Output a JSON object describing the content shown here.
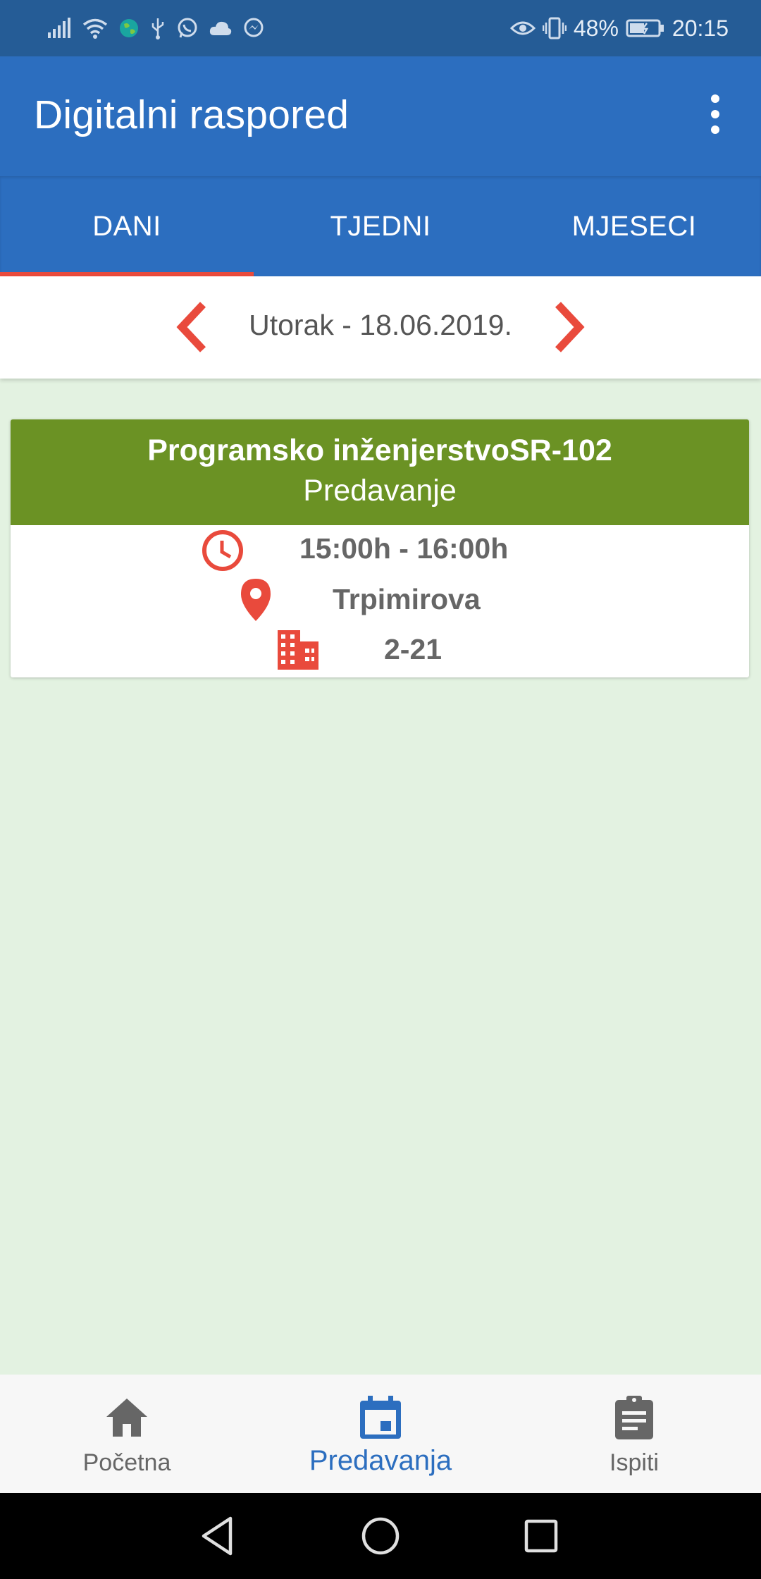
{
  "status_bar": {
    "battery_percent": "48%",
    "time": "20:15",
    "icons": [
      "signal-icon",
      "wifi-icon",
      "globe-icon",
      "usb-icon",
      "whatsapp-icon",
      "cloud-icon",
      "messenger-icon",
      "eye-icon",
      "vibrate-icon",
      "battery-icon"
    ]
  },
  "app_bar": {
    "title": "Digitalni raspored",
    "menu_icon": "more-vert-icon"
  },
  "tabs": [
    {
      "label": "DANI",
      "active": true
    },
    {
      "label": "TJEDNI",
      "active": false
    },
    {
      "label": "MJESECI",
      "active": false
    }
  ],
  "date_nav": {
    "date": "Utorak - 18.06.2019.",
    "prev_icon": "chevron-left-icon",
    "next_icon": "chevron-right-icon"
  },
  "lecture": {
    "title": "Programsko inženjerstvoSR-102",
    "type": "Predavanje",
    "time": "15:00h - 16:00h",
    "location": "Trpimirova",
    "room": "2-21",
    "header_color": "#6b9224"
  },
  "bottom_nav": [
    {
      "label": "Početna",
      "icon": "home-icon",
      "active": false
    },
    {
      "label": "Predavanja",
      "icon": "calendar-icon",
      "active": true
    },
    {
      "label": "Ispiti",
      "icon": "clipboard-icon",
      "active": false
    }
  ],
  "colors": {
    "primary": "#2c6ebf",
    "status_bar": "#255c96",
    "accent": "#e94a3c",
    "background": "#e3f2e1"
  }
}
